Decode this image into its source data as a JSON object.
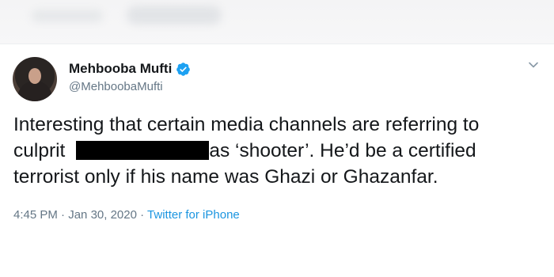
{
  "colors": {
    "primary_text": "#14171a",
    "secondary_text": "#657786",
    "link": "#1b95e0",
    "verified_badge": "#1da1f2"
  },
  "tweet": {
    "author": {
      "display_name": "Mehbooba Mufti",
      "handle": "@MehboobaMufti",
      "verified": true,
      "verified_icon": "verified-badge-icon",
      "avatar": "profile-photo"
    },
    "text": {
      "line1": "Interesting that certain media channels are referring to",
      "line2_start": "culprit",
      "line2_end": "as ‘shooter’. He’d be a certified",
      "line3": "terrorist only if his name was Ghazi or Ghazanfar."
    },
    "meta": {
      "time": "4:45 PM",
      "separator1": "·",
      "date": "Jan 30, 2020",
      "separator2": "·",
      "source": "Twitter for iPhone"
    },
    "menu_icon": "chevron-down-icon"
  }
}
